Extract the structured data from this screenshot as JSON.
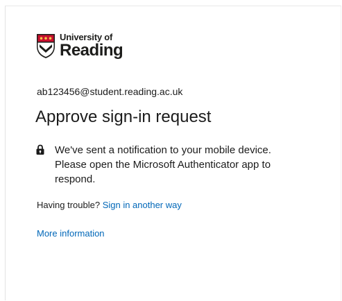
{
  "logo": {
    "line1": "University of",
    "line2": "Reading"
  },
  "identity": {
    "email": "ab123456@student.reading.ac.uk"
  },
  "title": "Approve sign-in request",
  "notice": {
    "icon": "lock-icon",
    "text": "We've sent a notification to your mobile device. Please open the Microsoft Authenticator app to respond."
  },
  "trouble": {
    "prefix": "Having trouble?",
    "link": "Sign in another way"
  },
  "more_info": "More information",
  "colors": {
    "link": "#0067b8",
    "text": "#1b1b1b",
    "crest_red": "#c8102e",
    "crest_dark": "#1d1d1b"
  }
}
